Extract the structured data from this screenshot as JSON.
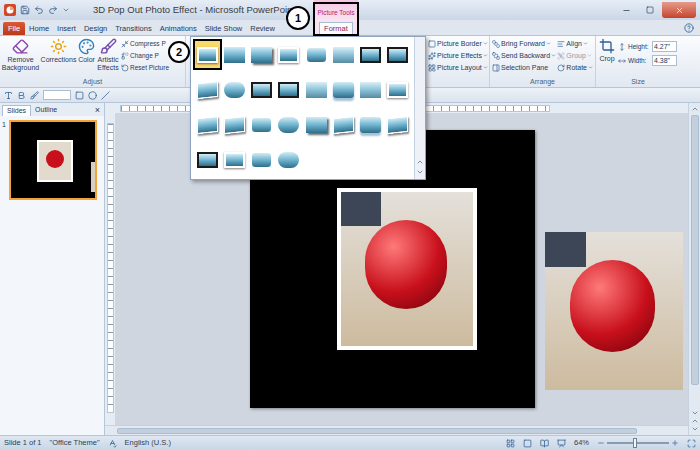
{
  "window": {
    "title": "3D Pop Out Photo Effect - Microsoft PowerPoint"
  },
  "contextual_tab": {
    "label": "Picture Tools"
  },
  "tabs": [
    {
      "label": "File",
      "kind": "file",
      "selected": false
    },
    {
      "label": "Home",
      "kind": "standard",
      "selected": false
    },
    {
      "label": "Insert",
      "kind": "standard",
      "selected": false
    },
    {
      "label": "Design",
      "kind": "standard",
      "selected": false
    },
    {
      "label": "Transitions",
      "kind": "standard",
      "selected": false
    },
    {
      "label": "Animations",
      "kind": "standard",
      "selected": false
    },
    {
      "label": "Slide Show",
      "kind": "standard",
      "selected": false
    },
    {
      "label": "Review",
      "kind": "standard",
      "selected": false
    },
    {
      "label": "Format",
      "kind": "contextual",
      "selected": true
    }
  ],
  "annotations": [
    "1",
    "2"
  ],
  "ribbon": {
    "adjust": {
      "label": "Adjust",
      "large_buttons": [
        "Remove Background",
        "Corrections",
        "Color",
        "Artistic Effects"
      ],
      "small_buttons": [
        "Compress P",
        "Change P",
        "Reset Picture"
      ]
    },
    "picture_styles": [
      {
        "kind": "frame",
        "selected": true
      },
      {
        "kind": "plain",
        "selected": false
      },
      {
        "kind": "shadow",
        "selected": false
      },
      {
        "kind": "frame",
        "selected": false
      },
      {
        "kind": "rounded",
        "selected": false
      },
      {
        "kind": "soft",
        "selected": false
      },
      {
        "kind": "dark-frame",
        "selected": false
      },
      {
        "kind": "dark-frame",
        "selected": false
      },
      {
        "kind": "tilt",
        "selected": false
      },
      {
        "kind": "oval",
        "selected": false
      },
      {
        "kind": "dark-frame",
        "selected": false
      },
      {
        "kind": "dark-frame",
        "selected": false
      },
      {
        "kind": "soft",
        "selected": false
      },
      {
        "kind": "reflect",
        "selected": false
      },
      {
        "kind": "soft",
        "selected": false
      },
      {
        "kind": "frame",
        "selected": false
      },
      {
        "kind": "tilt",
        "selected": false
      },
      {
        "kind": "tilt",
        "selected": false
      },
      {
        "kind": "rounded",
        "selected": false
      },
      {
        "kind": "oval",
        "selected": false
      },
      {
        "kind": "shadow",
        "selected": false
      },
      {
        "kind": "tilt",
        "selected": false
      },
      {
        "kind": "reflect",
        "selected": false
      },
      {
        "kind": "tilt",
        "selected": false
      },
      {
        "kind": "dark-frame",
        "selected": false
      },
      {
        "kind": "frame",
        "selected": false
      },
      {
        "kind": "rounded",
        "selected": false
      },
      {
        "kind": "oval",
        "selected": false
      }
    ],
    "picture_options": [
      "Picture Border",
      "Picture Effects",
      "Picture Layout"
    ],
    "arrange": {
      "label": "Arrange",
      "buttons": [
        {
          "label": "Bring Forward",
          "disabled": false
        },
        {
          "label": "Send Backward",
          "disabled": false
        },
        {
          "label": "Selection Pane",
          "disabled": false
        },
        {
          "label": "Align",
          "disabled": false
        },
        {
          "label": "Group",
          "disabled": true
        },
        {
          "label": "Rotate",
          "disabled": false
        }
      ]
    },
    "size": {
      "label": "Size",
      "crop": "Crop",
      "height_label": "Height:",
      "height": "4.27\"",
      "width_label": "Width:",
      "width": "4.38\""
    }
  },
  "slides_panel": {
    "tabs": [
      {
        "label": "Slides",
        "selected": true
      },
      {
        "label": "Outline",
        "selected": false
      }
    ],
    "close": "×",
    "slides": [
      {
        "number": "1",
        "selected": true
      }
    ]
  },
  "slide": {
    "photos": [
      {
        "kind": "framed"
      },
      {
        "kind": "plain"
      }
    ]
  },
  "status_bar": {
    "slide": "Slide 1 of 1",
    "theme": "\"Office Theme\"",
    "language": "English (U.S.)",
    "zoom": "64%",
    "zoom_level": 0.42
  }
}
